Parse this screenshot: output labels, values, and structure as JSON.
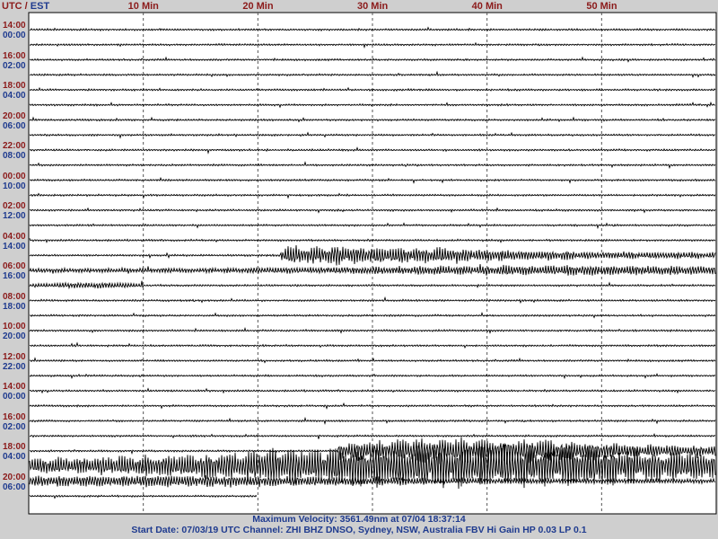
{
  "header": {
    "utc": "UTC",
    "sep": " / ",
    "est": "EST"
  },
  "colors": {
    "utc_label": "#8b1a1a",
    "est_label": "#1f3b8f",
    "trace": "#000000",
    "grid": "#555555",
    "plot_bg": "#ffffff",
    "frame_bg": "#cfcfcf"
  },
  "footer": {
    "line1": "Maximum Velocity: 3561.49nm at 07/04 18:37:14",
    "line2": "Start Date: 07/03/19 UTC Channel: ZHI  BHZ  DNSO, Sydney, NSW, Australia  FBV Hi Gain HP 0.03  LP 0.1"
  },
  "chart_data": {
    "type": "line",
    "subtype": "seismogram-helicorder",
    "x_axis": {
      "unit": "Min",
      "range": [
        0,
        60
      ],
      "ticks": [
        {
          "value": 10,
          "label": "10 Min"
        },
        {
          "value": 20,
          "label": "20 Min"
        },
        {
          "value": 30,
          "label": "30 Min"
        },
        {
          "value": 40,
          "label": "40 Min"
        },
        {
          "value": 50,
          "label": "50 Min"
        }
      ],
      "grid": "dashed-vertical"
    },
    "time_labels": [
      {
        "utc": "14:00",
        "est": "00:00",
        "row": 0
      },
      {
        "utc": "16:00",
        "est": "02:00",
        "row": 2
      },
      {
        "utc": "18:00",
        "est": "04:00",
        "row": 4
      },
      {
        "utc": "20:00",
        "est": "06:00",
        "row": 6
      },
      {
        "utc": "22:00",
        "est": "08:00",
        "row": 8
      },
      {
        "utc": "00:00",
        "est": "10:00",
        "row": 10
      },
      {
        "utc": "02:00",
        "est": "12:00",
        "row": 12
      },
      {
        "utc": "04:00",
        "est": "14:00",
        "row": 14
      },
      {
        "utc": "06:00",
        "est": "16:00",
        "row": 16
      },
      {
        "utc": "08:00",
        "est": "18:00",
        "row": 18
      },
      {
        "utc": "10:00",
        "est": "20:00",
        "row": 20
      },
      {
        "utc": "12:00",
        "est": "22:00",
        "row": 22
      },
      {
        "utc": "14:00",
        "est": "00:00",
        "row": 24
      },
      {
        "utc": "16:00",
        "est": "02:00",
        "row": 26
      },
      {
        "utc": "18:00",
        "est": "04:00",
        "row": 28
      },
      {
        "utc": "20:00",
        "est": "06:00",
        "row": 30
      }
    ],
    "rows": 32,
    "last_row_end_min": 20,
    "events": [
      {
        "row": 15,
        "start_min": 22,
        "end_min": 60,
        "peak_min": 27,
        "amp": 0.9,
        "note": "event onset"
      },
      {
        "row": 16,
        "start_min": 0,
        "end_min": 60,
        "peak_min": 48,
        "amp": 0.45
      },
      {
        "row": 17,
        "start_min": 0,
        "end_min": 10,
        "peak_min": 6,
        "amp": 0.25
      },
      {
        "row": 28,
        "start_min": 27,
        "end_min": 60,
        "peak_min": 38,
        "amp": 1.3
      },
      {
        "row": 29,
        "start_min": 0,
        "end_min": 60,
        "peak_min": 38,
        "amp": 2.2,
        "note": "maximum velocity"
      },
      {
        "row": 30,
        "start_min": 0,
        "end_min": 60,
        "peak_min": 10,
        "amp": 0.55
      }
    ]
  }
}
